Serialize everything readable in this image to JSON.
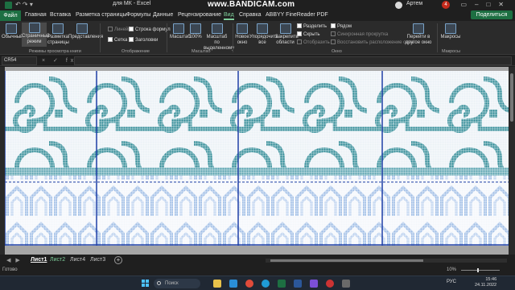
{
  "titlebar": {
    "title": "для МК  -  Excel",
    "recording_banner_prefix": "www.",
    "recording_banner": "BANDICAM",
    "recording_banner_suffix": ".com",
    "user": "Артем",
    "notification_count": "4"
  },
  "tabs": [
    {
      "label": "Файл"
    },
    {
      "label": "Главная"
    },
    {
      "label": "Вставка"
    },
    {
      "label": "Разметка страницы"
    },
    {
      "label": "Формулы"
    },
    {
      "label": "Данные"
    },
    {
      "label": "Рецензирование"
    },
    {
      "label": "Вид"
    },
    {
      "label": "Справка"
    },
    {
      "label": "ABBYY FineReader PDF"
    }
  ],
  "share_label": "Поделиться",
  "ribbon": {
    "views": {
      "normal": "Обычный",
      "page_mode_1": "Страничный",
      "page_mode_2": "режим",
      "layout_1": "Разметка",
      "layout_2": "страницы",
      "custom": "Представления",
      "group_label": "Режимы просмотра книги"
    },
    "show": {
      "ruler": "Линейка",
      "formula_bar": "Строка формул",
      "grid": "Сетка",
      "headings": "Заголовки",
      "group_label": "Отображение"
    },
    "zoom": {
      "zoom": "Масштаб",
      "hundred": "100%",
      "to_sel_1": "Масштаб по",
      "to_sel_2": "выделенному",
      "group_label": "Масштаб"
    },
    "window": {
      "new_1": "Новое",
      "new_2": "окно",
      "arrange_1": "Упорядочить",
      "arrange_2": "все",
      "freeze_1": "Закрепить",
      "freeze_2": "области",
      "split": "Разделить",
      "hide": "Скрыть",
      "unhide": "Отобразить",
      "side_by_side": "Рядом",
      "sync_scroll": "Синхронная прокрутка",
      "reset_pos": "Восстановить расположение окна",
      "switch_1": "Перейти в",
      "switch_2": "другое окно",
      "group_label": "Окно"
    },
    "macros": {
      "label": "Макросы",
      "group_label": "Макросы"
    }
  },
  "formula_bar": {
    "name_box": "CR54",
    "fx": "× ✓ fx",
    "value": ""
  },
  "sheets": [
    {
      "label": "Лист1",
      "state": "active"
    },
    {
      "label": "Лист2",
      "state": "colored"
    },
    {
      "label": "Лист4",
      "state": "normal"
    },
    {
      "label": "Лист3",
      "state": "normal"
    }
  ],
  "status": {
    "ready": "Готово",
    "zoom": "10%"
  },
  "taskbar": {
    "search_placeholder": "Поиск",
    "lang": "РУС",
    "time": "15:46",
    "date": "24.11.2022"
  },
  "colors": {
    "teal": "#2f8a96",
    "light_blue": "#9fbde6",
    "page_border": "#1f3fa6",
    "excel_green": "#1d6f42",
    "canvas_bg": "#a6a6a6"
  }
}
